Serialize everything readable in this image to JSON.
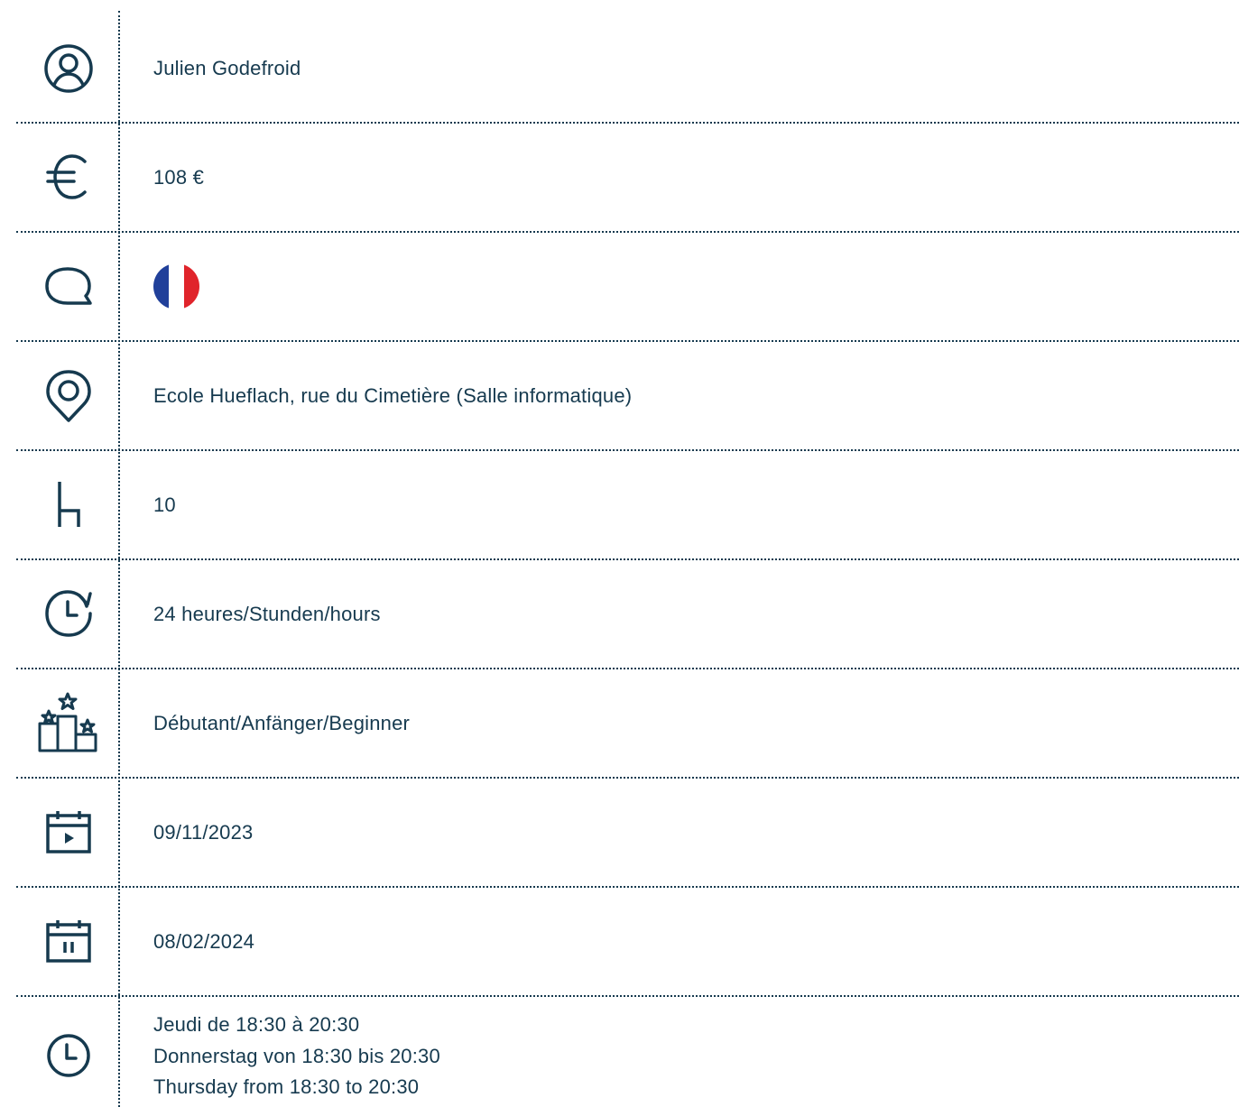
{
  "colors": {
    "text": "#163a4f",
    "flag_blue": "#21409a",
    "flag_white": "#ffffff",
    "flag_red": "#e0242b"
  },
  "rows": [
    {
      "icon": "user-icon",
      "text": "Julien Godefroid"
    },
    {
      "icon": "euro-icon",
      "text": "108 €"
    },
    {
      "icon": "speech-bubble-icon",
      "flag": "french-flag"
    },
    {
      "icon": "location-pin-icon",
      "text": "Ecole Hueflach, rue du Cimetière (Salle informatique)"
    },
    {
      "icon": "chair-icon",
      "text": "10"
    },
    {
      "icon": "clock-refresh-icon",
      "text": "24 heures/Stunden/hours"
    },
    {
      "icon": "podium-stars-icon",
      "text": "Débutant/Anfänger/Beginner"
    },
    {
      "icon": "calendar-start-icon",
      "text": "09/11/2023"
    },
    {
      "icon": "calendar-end-icon",
      "text": "08/02/2024"
    },
    {
      "icon": "clock-icon",
      "lines": [
        "Jeudi de 18:30 à 20:30",
        "Donnerstag von 18:30 bis 20:30",
        "Thursday from 18:30 to 20:30"
      ]
    }
  ]
}
